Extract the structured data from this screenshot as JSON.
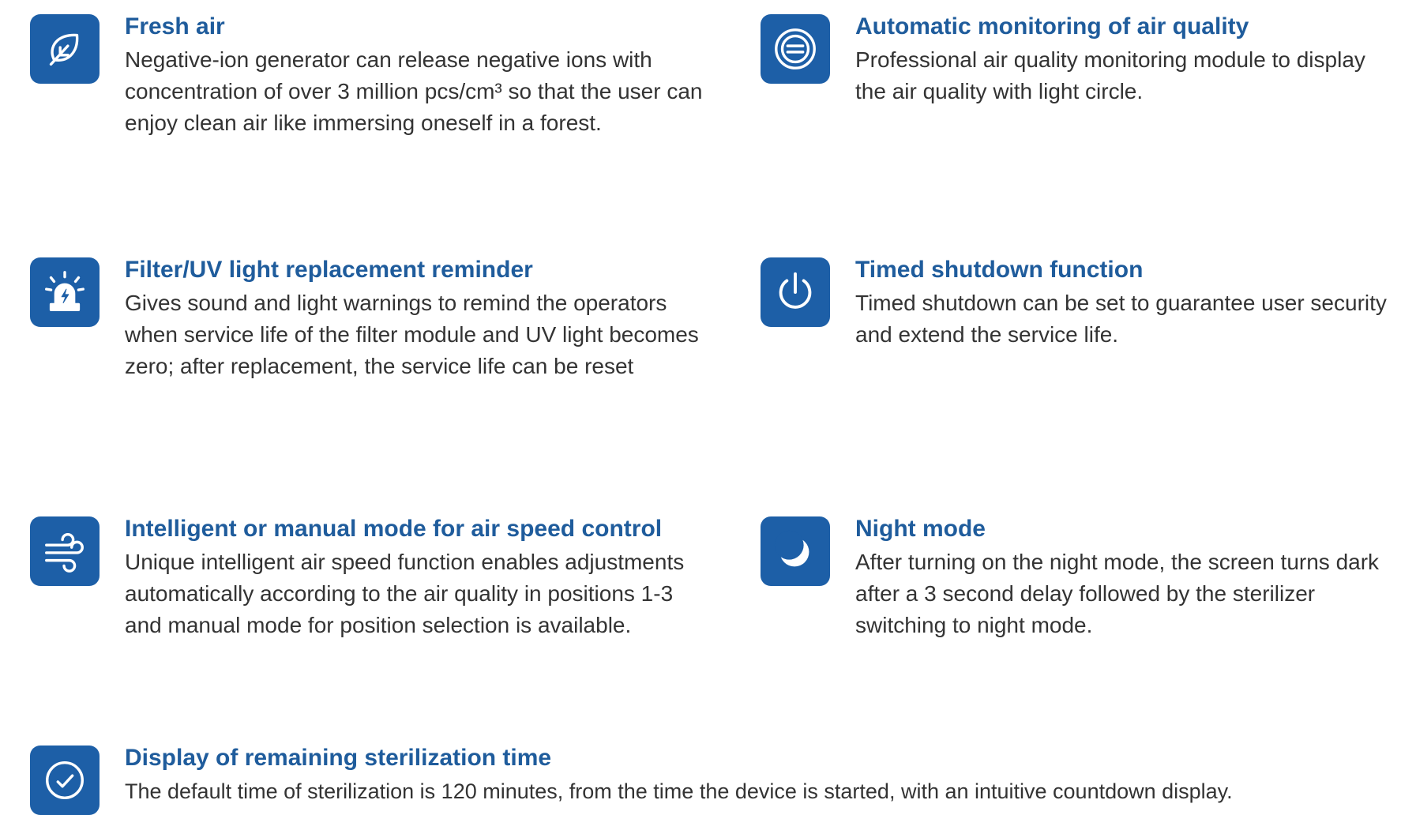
{
  "colors": {
    "accent": "#1d5fa7",
    "title": "#1f5c9c",
    "text": "#333333"
  },
  "features": [
    {
      "icon": "leaf-icon",
      "title": "Fresh air",
      "description": "Negative-ion generator can release negative ions with concentration of over 3 million pcs/cm³ so that the user can enjoy clean air like immersing oneself in a forest."
    },
    {
      "icon": "air-quality-monitor-icon",
      "title": "Automatic monitoring of air quality",
      "description": "Professional air quality monitoring module to display the air quality with light circle."
    },
    {
      "icon": "alarm-lamp-icon",
      "title": "Filter/UV light replacement reminder",
      "description": "Gives sound and light warnings to remind the operators when service life of the filter module and UV light becomes zero; after replacement, the service life can be reset"
    },
    {
      "icon": "power-icon",
      "title": "Timed shutdown function",
      "description": "Timed shutdown can be set to guarantee user security and extend the service life."
    },
    {
      "icon": "wind-icon",
      "title": "Intelligent or manual mode for air speed control",
      "description": "Unique intelligent air speed function enables adjustments automatically according to the air quality in positions 1-3 and manual mode for position selection is available."
    },
    {
      "icon": "moon-icon",
      "title": "Night mode",
      "description": "After turning on the night mode, the screen turns dark after a 3 second delay followed by the sterilizer switching to night mode."
    },
    {
      "icon": "clock-icon",
      "title": "Display of remaining sterilization time",
      "description": "The default time of sterilization is 120 minutes, from the time the device is started, with an intuitive countdown display."
    }
  ]
}
